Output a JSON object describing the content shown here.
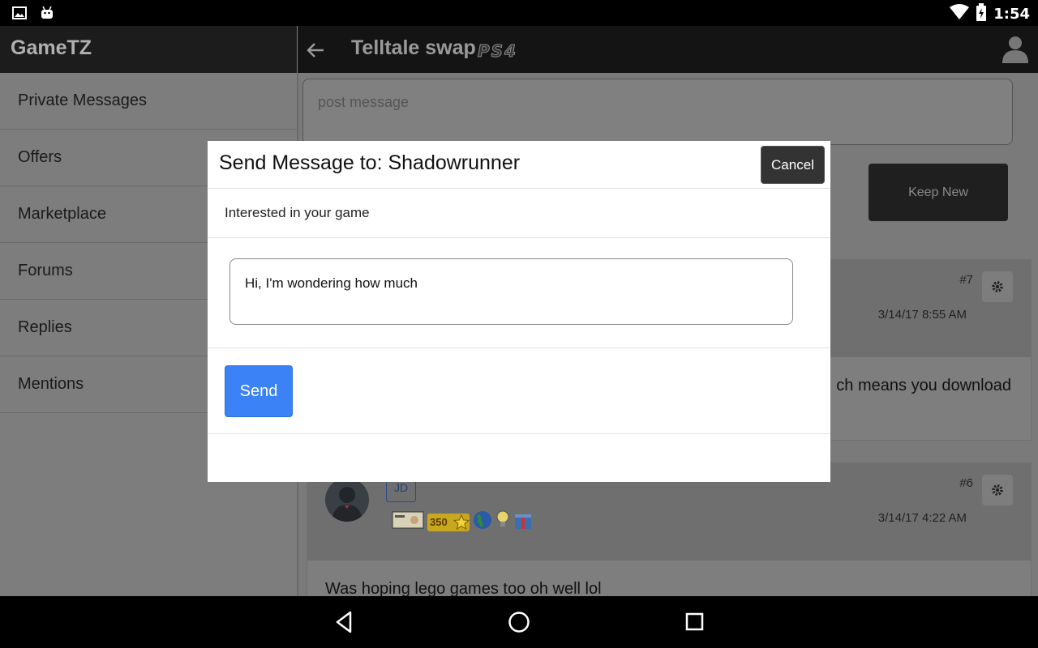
{
  "status_bar": {
    "time": "1:54",
    "icons": [
      "image-icon",
      "android-icon",
      "wifi-icon",
      "battery-icon"
    ]
  },
  "app": {
    "title": "GameTZ"
  },
  "header": {
    "title": "Telltale swap",
    "platform_logo": "PS4",
    "icons": [
      "back-arrow-icon",
      "profile-icon"
    ]
  },
  "sidebar": {
    "items": [
      {
        "label": "Private Messages"
      },
      {
        "label": "Offers"
      },
      {
        "label": "Marketplace"
      },
      {
        "label": "Forums"
      },
      {
        "label": "Replies"
      },
      {
        "label": "Mentions"
      }
    ]
  },
  "main": {
    "post_placeholder": "post message",
    "keep_new_label": "Keep New",
    "posts": [
      {
        "number": "#7",
        "date": "3/14/17 8:55 AM",
        "body_visible": "ch means you download"
      },
      {
        "number": "#6",
        "date": "3/14/17 4:22 AM",
        "user_badge": "JD",
        "badge_count": "350",
        "body": "Was hoping lego games too oh well lol"
      }
    ]
  },
  "modal": {
    "title": "Send Message to: Shadowrunner",
    "cancel_label": "Cancel",
    "subject": "Interested in your game",
    "message": "Hi, I'm wondering how much",
    "send_label": "Send"
  },
  "colors": {
    "send_button": "#3b82f6",
    "cancel_button": "#333333",
    "status_bar": "#000000"
  }
}
